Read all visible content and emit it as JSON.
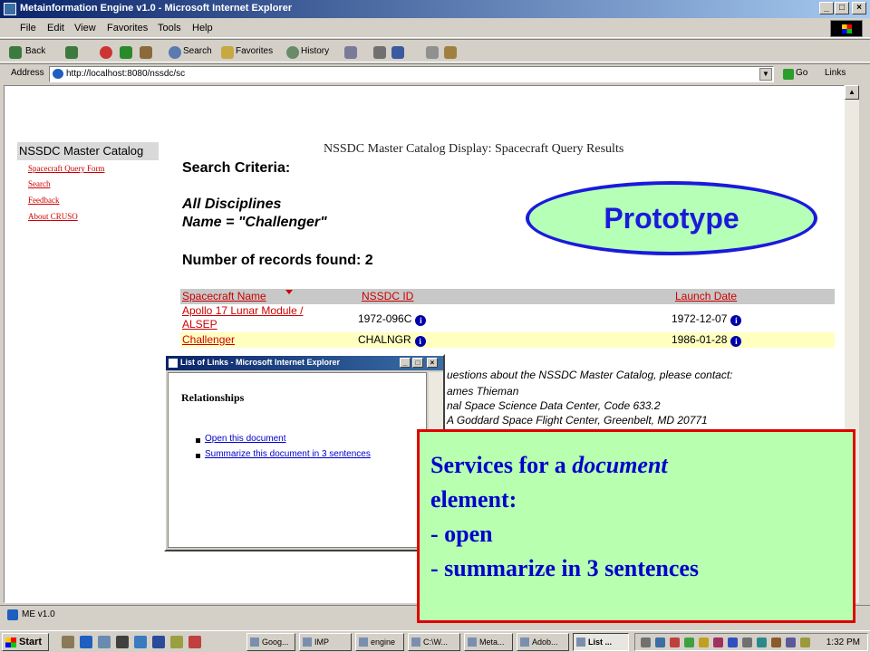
{
  "window": {
    "title": "Metainformation Engine v1.0 - Microsoft Internet Explorer",
    "min": "_",
    "max": "□",
    "close": "×"
  },
  "menu": [
    "File",
    "Edit",
    "View",
    "Favorites",
    "Tools",
    "Help"
  ],
  "toolbar": {
    "back": "Back",
    "search": "Search",
    "favorites": "Favorites",
    "history": "History"
  },
  "address": {
    "label": "Address",
    "url": "http://localhost:8080/nssdc/sc",
    "go": "Go",
    "links": "Links"
  },
  "sidebar": {
    "title": "NSSDC Master Catalog",
    "links": [
      "Spacecraft Query Form",
      "Search",
      "Feedback",
      "About CRUSO"
    ]
  },
  "page": {
    "heading": "NSSDC Master Catalog Display: Spacecraft Query Results",
    "search_criteria": "Search Criteria:",
    "disciplines": "All Disciplines",
    "name_filter": "Name = \"Challenger\"",
    "records_found": "Number of records found: 2"
  },
  "table": {
    "headers": [
      "Spacecraft Name",
      "NSSDC ID",
      "Launch Date"
    ],
    "rows": [
      {
        "name_line1": "Apollo 17 Lunar Module /",
        "name_line2": "ALSEP",
        "id": "1972-096C",
        "date": "1972-12-07"
      },
      {
        "name_line1": "Challenger",
        "id": "CHALNGR",
        "date": "1986-01-28"
      }
    ],
    "info_glyph": "i"
  },
  "contact": {
    "line1": "uestions about the NSSDC Master Catalog, please contact:",
    "line2": "ames Thieman",
    "line3": "nal Space Science Data Center, Code 633.2",
    "line4": "A Goddard Space Flight Center, Greenbelt, MD 20771"
  },
  "popup": {
    "title": "List of Links - Microsoft Internet Explorer",
    "heading": "Relationships",
    "links": [
      "Open this document",
      "Summarize this document in 3 sentences"
    ]
  },
  "overlays": {
    "prototype": "Prototype",
    "services_line1": "Services for a ",
    "services_line1_em": "document",
    "services_line2": "element:",
    "services_line3": "- open",
    "services_line4": "- summarize in 3 sentences"
  },
  "status": {
    "text": "ME v1.0"
  },
  "taskbar": {
    "start": "Start",
    "tasks": [
      "Goog...",
      "IMP",
      "engine",
      "C:\\W...",
      "Meta...",
      "Adob...",
      "List ..."
    ],
    "clock": "1:32 PM"
  },
  "colors": {
    "link_red": "#cc0000",
    "prototype_blue": "#1a1adc",
    "services_border": "#e00000",
    "overlay_green": "#b8ffb0"
  }
}
